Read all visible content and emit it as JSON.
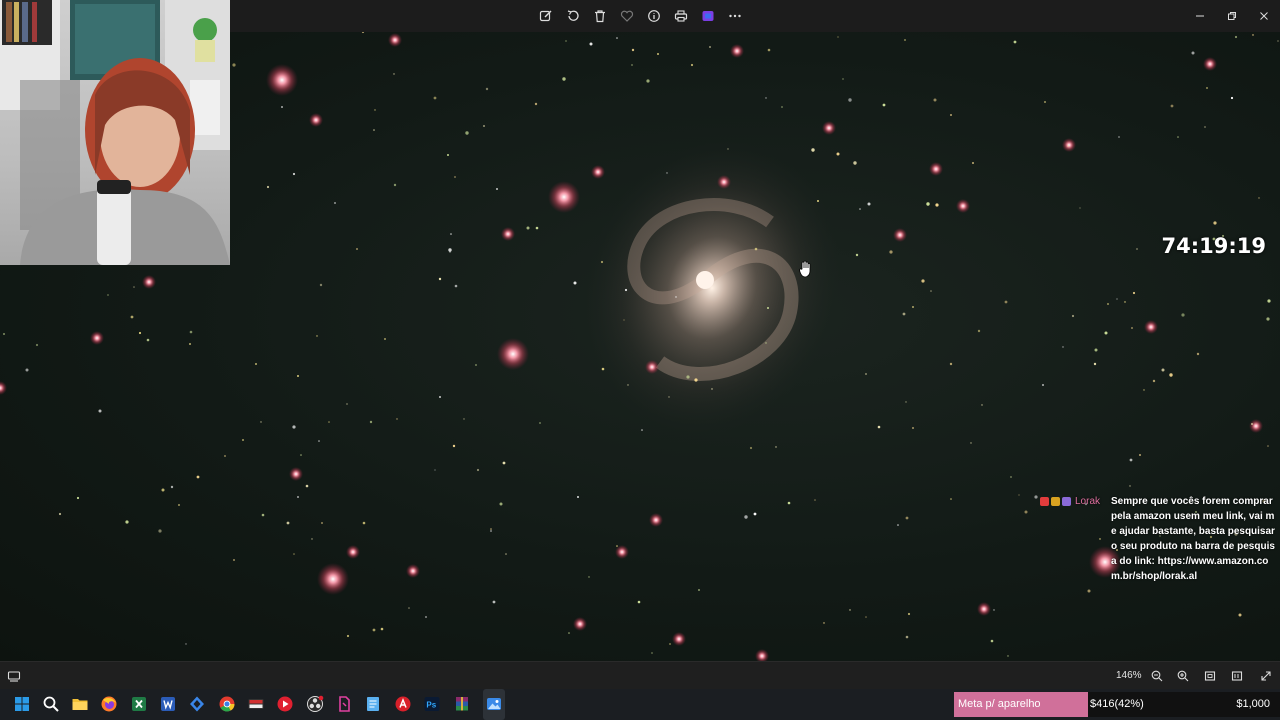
{
  "toolbar": {
    "buttons": [
      {
        "name": "edit-image-button",
        "icon": "edit-icon"
      },
      {
        "name": "rotate-button",
        "icon": "rotate-icon"
      },
      {
        "name": "delete-button",
        "icon": "trash-icon"
      },
      {
        "name": "favorite-button",
        "icon": "heart-icon"
      },
      {
        "name": "info-button",
        "icon": "info-icon"
      },
      {
        "name": "print-button",
        "icon": "printer-icon"
      },
      {
        "name": "clipchamp-button",
        "icon": "clipchamp-icon"
      },
      {
        "name": "more-button",
        "icon": "ellipsis-icon"
      }
    ]
  },
  "window_controls": [
    "minimize",
    "maximize",
    "close"
  ],
  "stream": {
    "timer": "74:19:19"
  },
  "chat": {
    "username": "Lorak",
    "message": "Sempre que vocês forem comprar pela amazon usem meu link, vai me ajudar bastante, basta pesquisar o seu produto na barra de pesquisa do link: https://www.amazon.com.br/shop/lorak.al",
    "badge_colors": [
      "#e23c3c",
      "#d9a220",
      "#8a6ad8"
    ]
  },
  "viewer": {
    "zoom": "146%"
  },
  "goal": {
    "label": "Meta p/ aparelho",
    "current": "$416(42%)",
    "target": "$1,000",
    "progress": 0.42,
    "color": "#d0709a"
  },
  "taskbar": {
    "apps": [
      "windows-start",
      "search",
      "file-explorer",
      "firefox",
      "excel",
      "word",
      "app-blue",
      "chrome",
      "app-streamer",
      "app-red-play",
      "app-obs",
      "app-pink",
      "notepad",
      "app-red-circle",
      "photoshop",
      "winrar",
      "photos"
    ]
  },
  "colors": {
    "star_red": "#ff5a6e",
    "star_yellow": "#f0e08a",
    "galaxy_core": "#ffe0d0"
  }
}
